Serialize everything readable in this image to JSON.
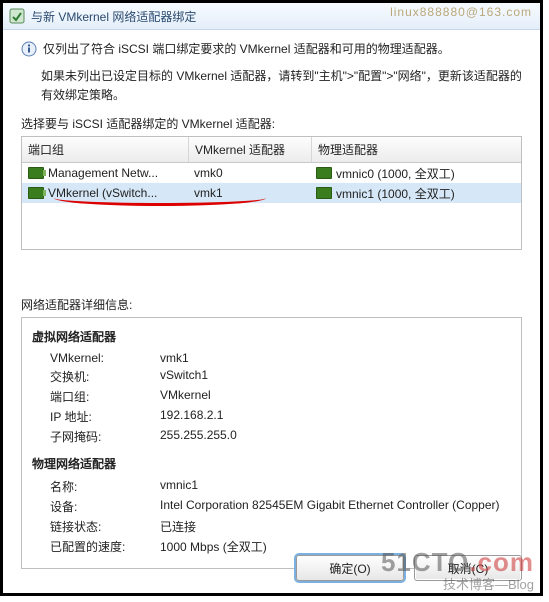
{
  "watermark_top": "linux888880@163.com",
  "window": {
    "title": "与新 VMkernel 网络适配器绑定"
  },
  "intro": {
    "line1": "仅列出了符合 iSCSI 端口绑定要求的 VMkernel 适配器和可用的物理适配器。",
    "line2": "如果未列出已设定目标的 VMkernel 适配器，请转到\"主机\">\"配置\">\"网络\"，更新该适配器的有效绑定策略。",
    "pick": "选择要与 iSCSI 适配器绑定的 VMkernel 适配器:"
  },
  "grid": {
    "headers": {
      "c0": "端口组",
      "c1": "VMkernel 适配器",
      "c2": "物理适配器"
    },
    "rows": [
      {
        "pg": "Management Netw...",
        "vmk": "vmk0",
        "phys": "vmnic0 (1000, 全双工)",
        "selected": false
      },
      {
        "pg": "VMkernel (vSwitch...",
        "vmk": "vmk1",
        "phys": "vmnic1 (1000, 全双工)",
        "selected": true
      }
    ]
  },
  "detail_label": "网络适配器详细信息:",
  "virtual": {
    "title": "虚拟网络适配器",
    "vmkernel_k": "VMkernel:",
    "vmkernel_v": "vmk1",
    "switch_k": "交换机:",
    "switch_v": "vSwitch1",
    "pg_k": "端口组:",
    "pg_v": "VMkernel",
    "ip_k": "IP 地址:",
    "ip_v": "192.168.2.1",
    "mask_k": "子网掩码:",
    "mask_v": "255.255.255.0"
  },
  "physical": {
    "title": "物理网络适配器",
    "name_k": "名称:",
    "name_v": "vmnic1",
    "dev_k": "设备:",
    "dev_v": "Intel Corporation 82545EM Gigabit Ethernet Controller (Copper)",
    "link_k": "链接状态:",
    "link_v": "已连接",
    "speed_k": "已配置的速度:",
    "speed_v": "1000 Mbps (全双工)"
  },
  "buttons": {
    "ok": "确定(O)",
    "cancel": "取消(C)"
  },
  "watermark_bottom": {
    "line1a": "51CTO",
    "line1b": ".com",
    "line2": "技术博客—Blog"
  }
}
